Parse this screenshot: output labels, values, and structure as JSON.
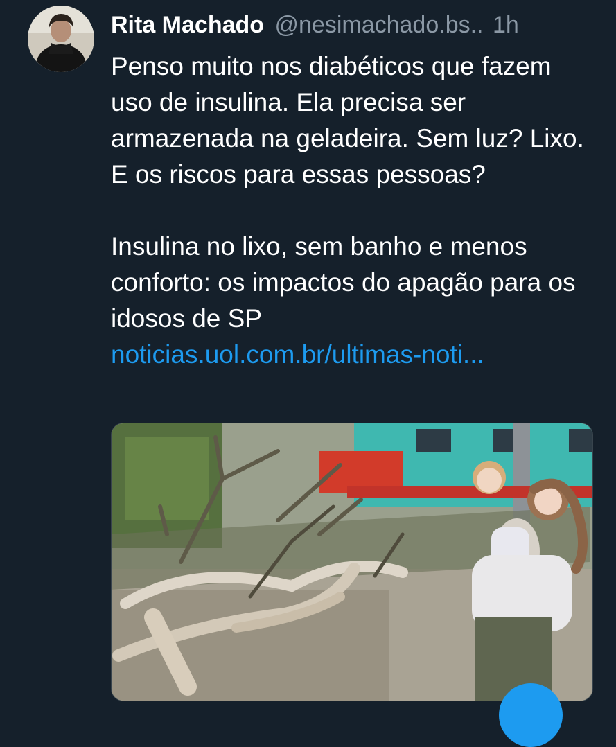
{
  "tweet": {
    "author_name": "Rita Machado",
    "handle": "@nesimachado.bs..",
    "timestamp": "1h",
    "paragraph_1": "Penso muito nos diabéticos que fazem uso de insulina. Ela precisa ser armazenada na geladeira. Sem luz? Lixo. E os riscos para essas pessoas?",
    "paragraph_2": "Insulina no lixo, sem banho e menos conforto: os impactos do apagão para os idosos de SP",
    "link_text": "noticias.uol.com.br/ultimas-noti..."
  },
  "colors": {
    "background": "#15202b",
    "text_primary": "#ffffff",
    "text_secondary": "#8b98a5",
    "link": "#1d9bf0",
    "card_border": "#38444d"
  },
  "icons": {
    "compose": "compose-fab-icon"
  }
}
